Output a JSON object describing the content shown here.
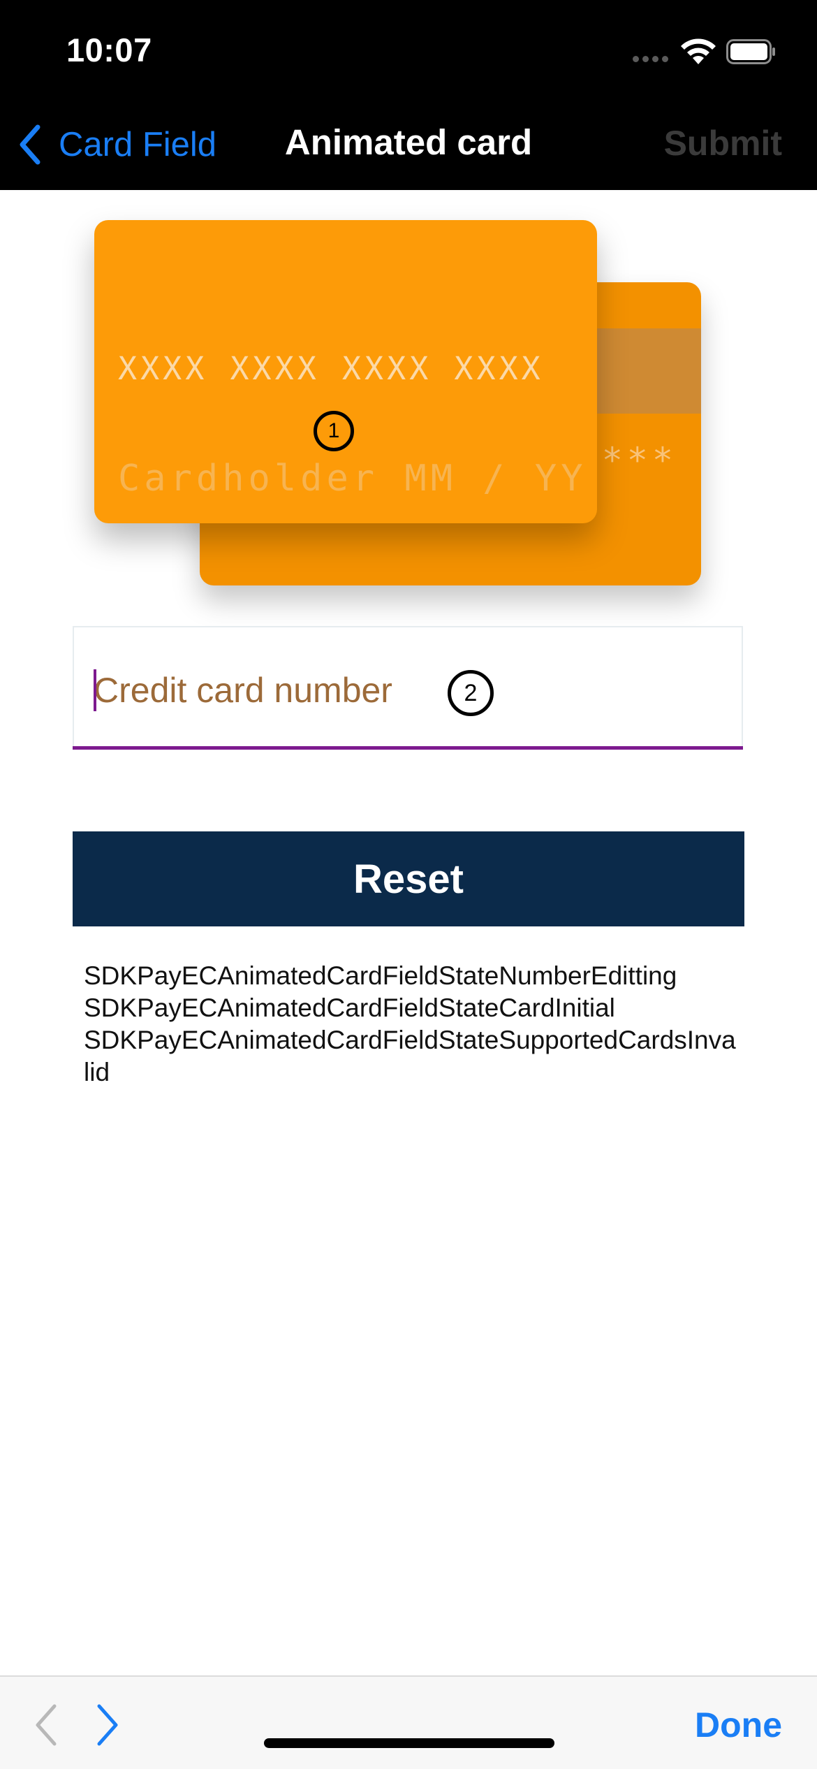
{
  "status_bar": {
    "time": "10:07"
  },
  "nav": {
    "back_label": "Card Field",
    "title": "Animated card",
    "submit_label": "Submit"
  },
  "card": {
    "number_placeholder": "XXXX XXXX XXXX XXXX",
    "holder_placeholder": "Cardholder",
    "expiry_placeholder": "MM / YY",
    "cvv_placeholder": "***",
    "marker_front": "1"
  },
  "input": {
    "placeholder": "Credit card number",
    "value": "",
    "marker": "2"
  },
  "reset": {
    "label": "Reset"
  },
  "log": {
    "lines": [
      "SDKPayECAnimatedCardFieldStateNumberEditting",
      "SDKPayECAnimatedCardFieldStateCardInitial",
      "SDKPayECAnimatedCardFieldStateSupportedCardsInvalid"
    ]
  },
  "toolbar": {
    "done_label": "Done"
  },
  "colors": {
    "accent_blue": "#1a7ef5",
    "card_front": "#fd9b08",
    "card_back": "#f39100",
    "reset_button": "#0b2a4a",
    "input_underline": "#7d1a8f"
  }
}
